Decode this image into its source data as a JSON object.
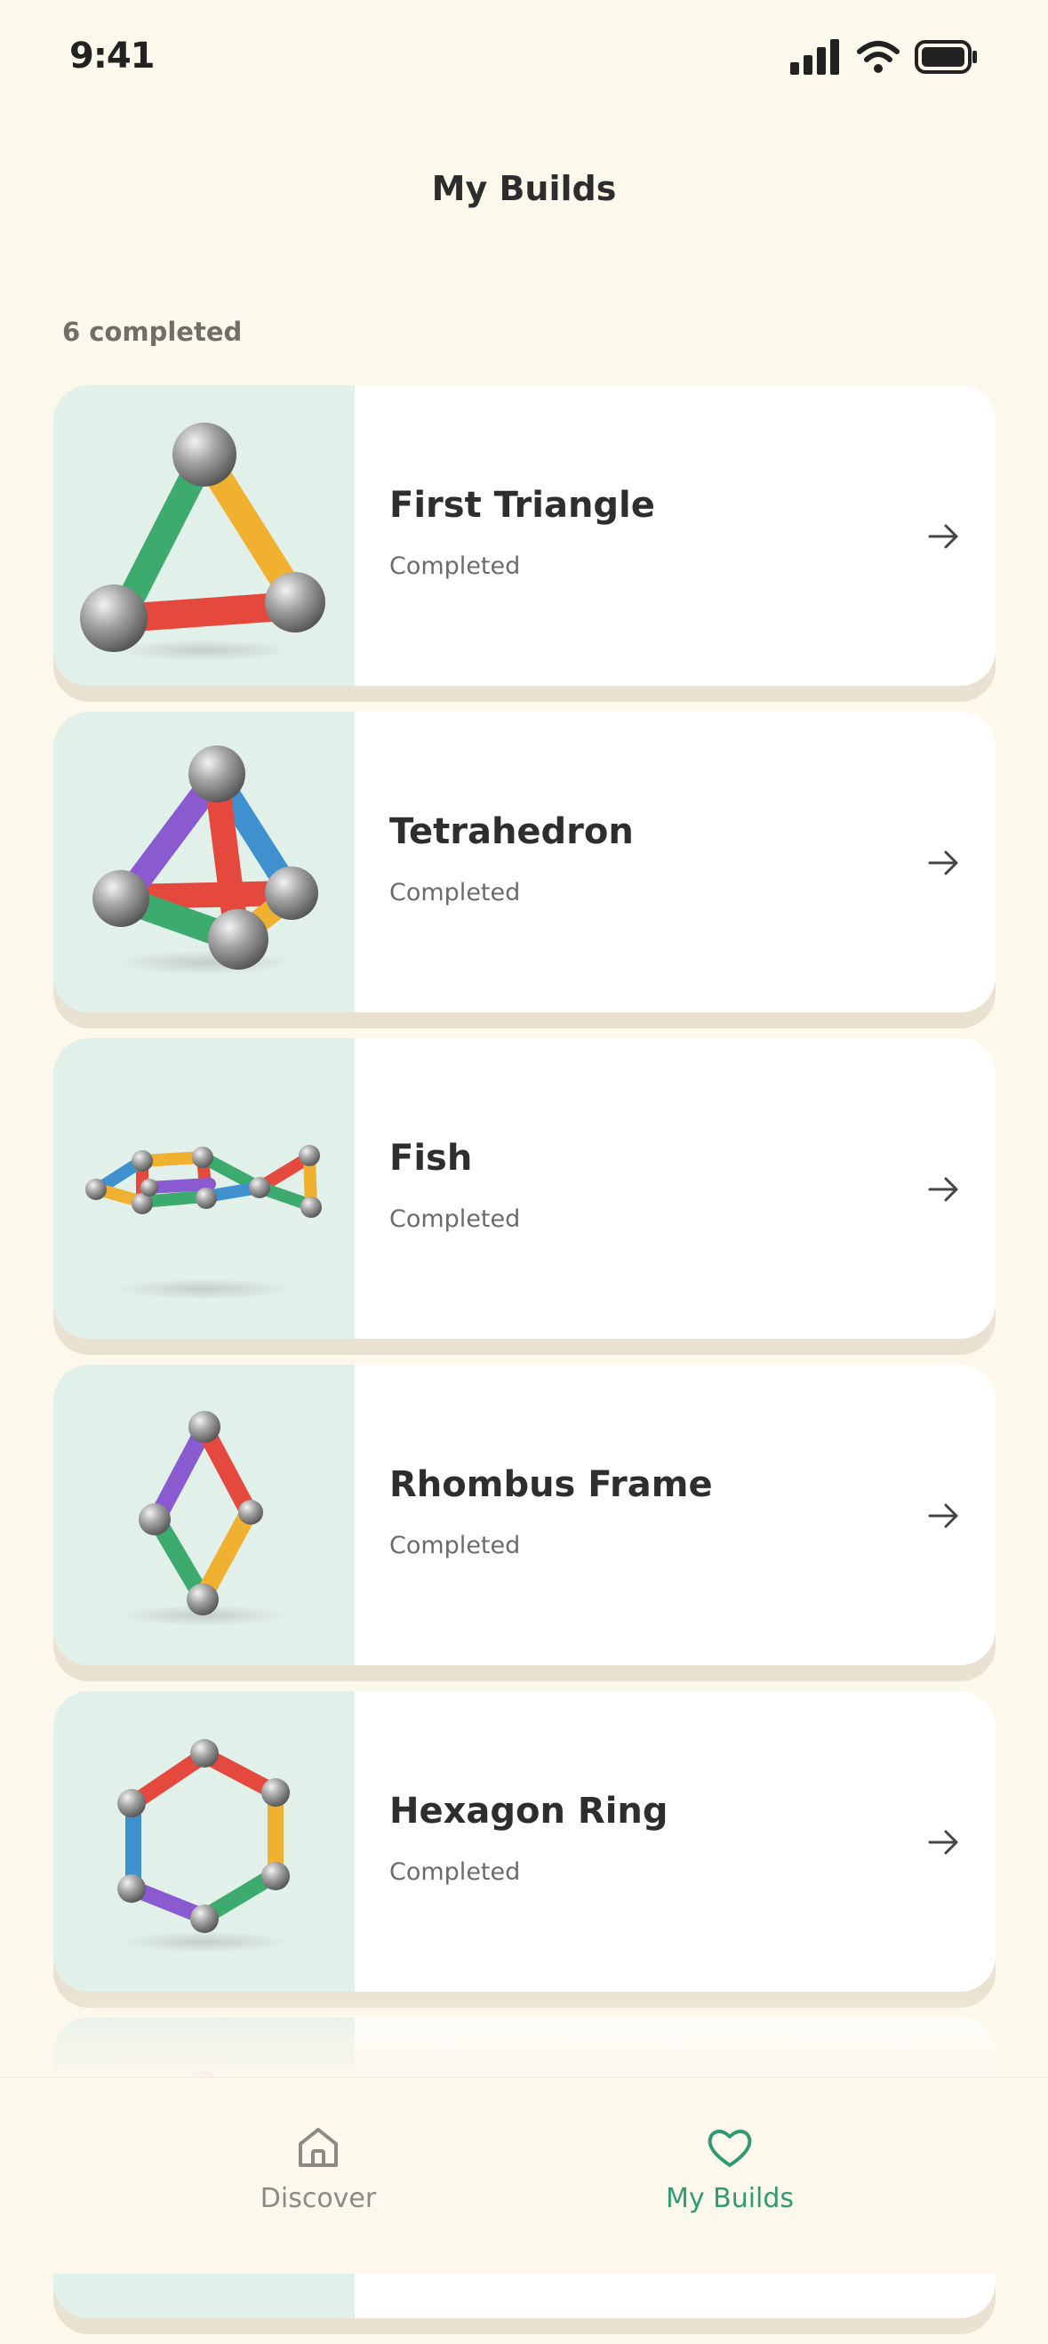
{
  "status_bar": {
    "time": "9:41"
  },
  "header": {
    "title": "My Builds"
  },
  "summary": {
    "count_label": "6 completed"
  },
  "builds": [
    {
      "title": "First Triangle",
      "status": "Completed",
      "icon": "triangle-model"
    },
    {
      "title": "Tetrahedron",
      "status": "Completed",
      "icon": "tetrahedron-model"
    },
    {
      "title": "Fish",
      "status": "Completed",
      "icon": "fish-model"
    },
    {
      "title": "Rhombus Frame",
      "status": "Completed",
      "icon": "rhombus-model"
    },
    {
      "title": "Hexagon Ring",
      "status": "Completed",
      "icon": "hexagon-model"
    },
    {
      "title": "",
      "status": "",
      "icon": "partial-model"
    }
  ],
  "tab_bar": {
    "tabs": [
      {
        "label": "Discover",
        "icon": "home-icon",
        "active": false
      },
      {
        "label": "My Builds",
        "icon": "heart-icon",
        "active": true
      }
    ]
  },
  "colors": {
    "background": "#FDF8EC",
    "card": "#FFFFFF",
    "thumbnail": "#E2F0EA",
    "accent": "#2F9A73",
    "rod_red": "#E5493E",
    "rod_yellow": "#F0B030",
    "rod_green": "#3DAA6E",
    "rod_blue": "#3F90CE",
    "rod_purple": "#8A5AD0"
  }
}
